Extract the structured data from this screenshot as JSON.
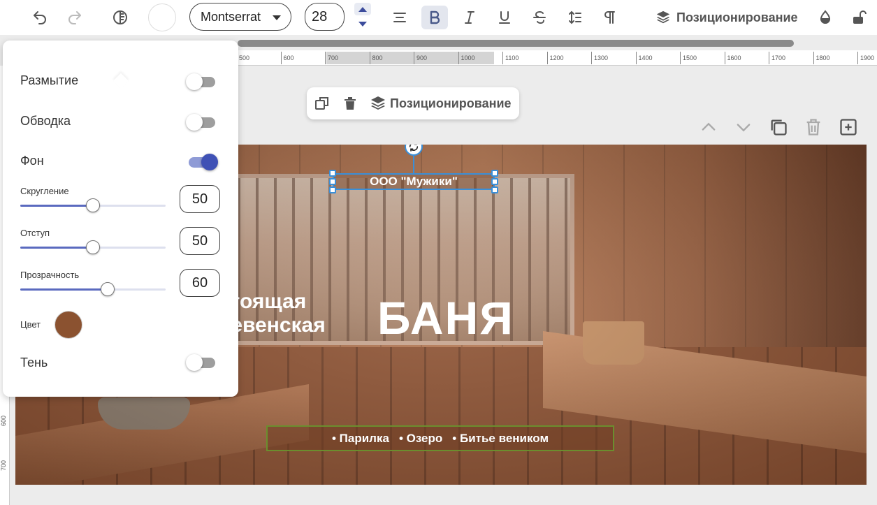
{
  "toolbar": {
    "font_family": "Montserrat",
    "font_size": "28",
    "positioning_label": "Позиционирование",
    "bold_active": true
  },
  "ruler": {
    "ticks": [
      "500",
      "600",
      "700",
      "800",
      "900",
      "1000",
      "1100",
      "1200",
      "1300",
      "1400",
      "1500",
      "1600",
      "1700",
      "1800",
      "1900"
    ],
    "vertical_ticks": [
      "600",
      "700"
    ]
  },
  "float_toolbar": {
    "positioning_label": "Позиционирование"
  },
  "panel": {
    "blur_label": "Размытие",
    "blur_on": false,
    "stroke_label": "Обводка",
    "stroke_on": false,
    "background_label": "Фон",
    "background_on": true,
    "rounding_label": "Скругление",
    "rounding_value": "50",
    "rounding_fraction": 0.5,
    "padding_label": "Отступ",
    "padding_value": "50",
    "padding_fraction": 0.5,
    "opacity_label": "Прозрачность",
    "opacity_value": "60",
    "opacity_fraction": 0.6,
    "color_label": "Цвет",
    "color_value": "#8b5230",
    "shadow_label": "Тень",
    "shadow_on": false
  },
  "canvas": {
    "company": "ООО \"Мужики\"",
    "headline_line1": "стоящая",
    "headline_line2": "ревенская",
    "headline_big": "БАНЯ",
    "services": [
      "• Парилка",
      "• Озеро",
      "• Битье веником"
    ]
  },
  "colors": {
    "accent": "#3f51b5",
    "selection": "#3a8fd8",
    "services_border": "#6b8e2e"
  }
}
